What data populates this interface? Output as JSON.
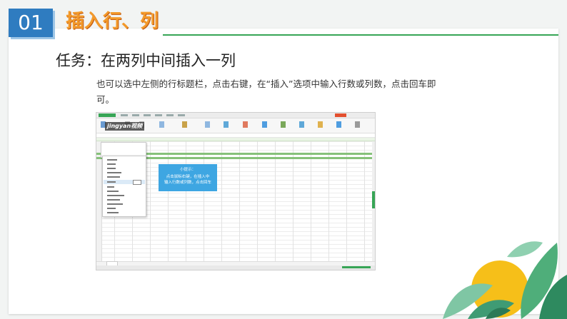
{
  "header": {
    "number": "01",
    "title": "插入行、列"
  },
  "task": "任务：在两列中间插入一列",
  "description": "也可以选中左侧的行标题栏，点击右键，在“插入”选项中输入行数或列数，点击回车即可。",
  "screenshot": {
    "watermark": "jingyan视频",
    "tip_title": "小提示：",
    "tip_line1": "点击鼠标右键，在插入中",
    "tip_line2": "输入行数或列数，点击回车"
  },
  "colors": {
    "badge": "#2f7cc0",
    "title": "#f39a2b",
    "rule": "#37a556",
    "tip": "#3ea6e2",
    "sun": "#f5b800"
  },
  "decoration": {
    "icon": "leaf-sun-icon"
  }
}
